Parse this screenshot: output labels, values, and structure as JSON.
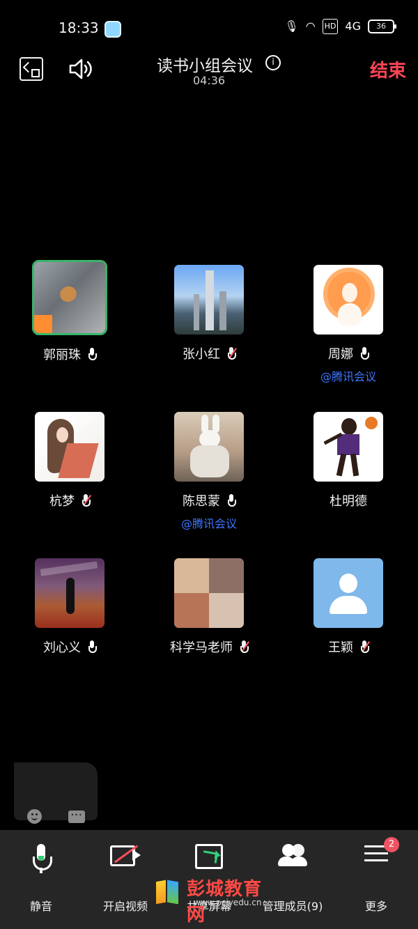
{
  "status": {
    "time": "18:33",
    "mic": "🎙",
    "wifi": "◠",
    "hd": "HD",
    "signal": "4G",
    "battery": "36"
  },
  "header": {
    "title": "读书小组会议",
    "info_icon": "i",
    "timer": "04:36",
    "end_label": "结束"
  },
  "participants": [
    {
      "name": "郭丽珠",
      "mic": "on",
      "subtitle": ""
    },
    {
      "name": "张小红",
      "mic": "off",
      "subtitle": ""
    },
    {
      "name": "周娜",
      "mic": "on",
      "subtitle": "@腾讯会议"
    },
    {
      "name": "杭梦",
      "mic": "off",
      "subtitle": ""
    },
    {
      "name": "陈思蒙",
      "mic": "on",
      "subtitle": "@腾讯会议"
    },
    {
      "name": "杜明德",
      "mic": "",
      "subtitle": ""
    },
    {
      "name": "刘心义",
      "mic": "on",
      "subtitle": ""
    },
    {
      "name": "科学马老师",
      "mic": "off",
      "subtitle": ""
    },
    {
      "name": "王颖",
      "mic": "off",
      "subtitle": ""
    }
  ],
  "bottom": {
    "mute": "静音",
    "video": "开启视频",
    "share": "共享屏幕",
    "members": "管理成员(9)",
    "more": "更多",
    "badge": "2"
  },
  "watermark": {
    "main": "彭城教育网",
    "sub": "www.pcjyedu.cn"
  },
  "colors": {
    "background": "#000000",
    "accent_red": "#ff4655",
    "accent_green": "#39b56a",
    "link_blue": "#3f76ff",
    "bottom_bar": "#262626"
  }
}
